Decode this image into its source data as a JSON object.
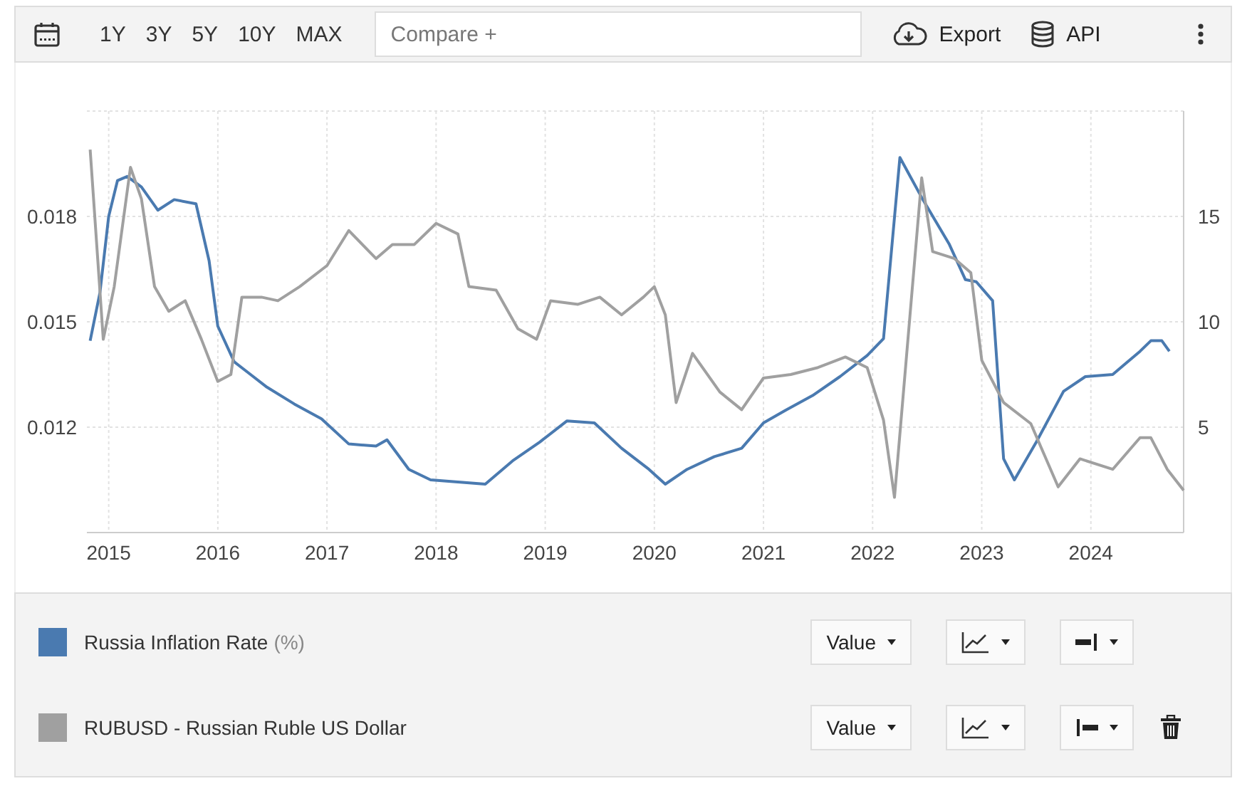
{
  "toolbar": {
    "ranges": [
      "1Y",
      "3Y",
      "5Y",
      "10Y",
      "MAX"
    ],
    "compare": {
      "placeholder": "Compare +"
    },
    "export": "Export",
    "api": "API"
  },
  "chart": {
    "chart_data": {
      "type": "line",
      "xlim": [
        2014.8,
        2024.85
      ],
      "ylim": [
        0.009,
        0.021
      ],
      "grid": true,
      "y2lim": [
        0,
        20
      ],
      "xticks": [
        2015,
        2016,
        2017,
        2018,
        2019,
        2020,
        2021,
        2022,
        2023,
        2024
      ],
      "yticks": [
        0.012,
        0.015,
        0.018
      ],
      "y2ticks": [
        5,
        10,
        15
      ],
      "series": [
        {
          "name": "Russia Inflation Rate",
          "color": "#4a7ab0",
          "axis": "y2",
          "x": [
            2014.83,
            2014.92,
            2015.0,
            2015.08,
            2015.17,
            2015.3,
            2015.45,
            2015.6,
            2015.8,
            2015.92,
            2016.0,
            2016.15,
            2016.3,
            2016.45,
            2016.7,
            2016.95,
            2017.2,
            2017.45,
            2017.55,
            2017.75,
            2017.95,
            2018.2,
            2018.45,
            2018.7,
            2018.95,
            2019.2,
            2019.45,
            2019.7,
            2019.95,
            2020.1,
            2020.3,
            2020.55,
            2020.8,
            2021.0,
            2021.2,
            2021.45,
            2021.7,
            2021.95,
            2022.1,
            2022.25,
            2022.45,
            2022.7,
            2022.85,
            2022.95,
            2023.1,
            2023.2,
            2023.3,
            2023.5,
            2023.75,
            2023.95,
            2024.2,
            2024.45,
            2024.55,
            2024.65,
            2024.72
          ],
          "values": [
            9.1,
            11.4,
            15.0,
            16.7,
            16.9,
            16.4,
            15.3,
            15.8,
            15.6,
            12.9,
            9.8,
            8.1,
            7.5,
            6.9,
            6.1,
            5.4,
            4.2,
            4.1,
            4.4,
            3.0,
            2.5,
            2.4,
            2.3,
            3.4,
            4.3,
            5.3,
            5.2,
            4.0,
            3.0,
            2.3,
            3.0,
            3.6,
            4.0,
            5.2,
            5.8,
            6.5,
            7.4,
            8.4,
            9.2,
            17.8,
            15.9,
            13.7,
            12.0,
            11.9,
            11.0,
            3.5,
            2.5,
            4.3,
            6.7,
            7.4,
            7.5,
            8.6,
            9.1,
            9.1,
            8.6
          ]
        },
        {
          "name": "RUBUSD - Russian Ruble US Dollar",
          "color": "#a0a0a0",
          "x": [
            2014.83,
            2014.95,
            2015.05,
            2015.2,
            2015.3,
            2015.42,
            2015.55,
            2015.7,
            2015.85,
            2016.0,
            2016.12,
            2016.22,
            2016.4,
            2016.55,
            2016.75,
            2017.0,
            2017.2,
            2017.45,
            2017.6,
            2017.8,
            2018.0,
            2018.2,
            2018.3,
            2018.55,
            2018.75,
            2018.92,
            2019.05,
            2019.3,
            2019.5,
            2019.7,
            2019.9,
            2020.0,
            2020.1,
            2020.2,
            2020.35,
            2020.6,
            2020.8,
            2021.0,
            2021.25,
            2021.5,
            2021.75,
            2021.95,
            2022.1,
            2022.2,
            2022.45,
            2022.55,
            2022.75,
            2022.9,
            2023.0,
            2023.2,
            2023.45,
            2023.7,
            2023.9,
            2024.2,
            2024.45,
            2024.55,
            2024.7,
            2024.85
          ],
          "values": [
            0.0199,
            0.0145,
            0.016,
            0.0194,
            0.0185,
            0.016,
            0.0153,
            0.0156,
            0.0145,
            0.0133,
            0.0135,
            0.0157,
            0.0157,
            0.0156,
            0.016,
            0.0166,
            0.0176,
            0.0168,
            0.0172,
            0.0172,
            0.0178,
            0.0175,
            0.016,
            0.0159,
            0.0148,
            0.0145,
            0.0156,
            0.0155,
            0.0157,
            0.0152,
            0.0157,
            0.016,
            0.0152,
            0.0127,
            0.0141,
            0.013,
            0.0125,
            0.0134,
            0.0135,
            0.0137,
            0.014,
            0.0137,
            0.0122,
            0.01,
            0.0191,
            0.017,
            0.0168,
            0.0164,
            0.0139,
            0.0127,
            0.0121,
            0.0103,
            0.0111,
            0.0108,
            0.0117,
            0.0117,
            0.0108,
            0.0102
          ]
        }
      ]
    }
  },
  "legend": [
    {
      "unit": "(%)",
      "mode": "Value",
      "deletable": false
    },
    {
      "mode": "Value",
      "deletable": true
    }
  ]
}
